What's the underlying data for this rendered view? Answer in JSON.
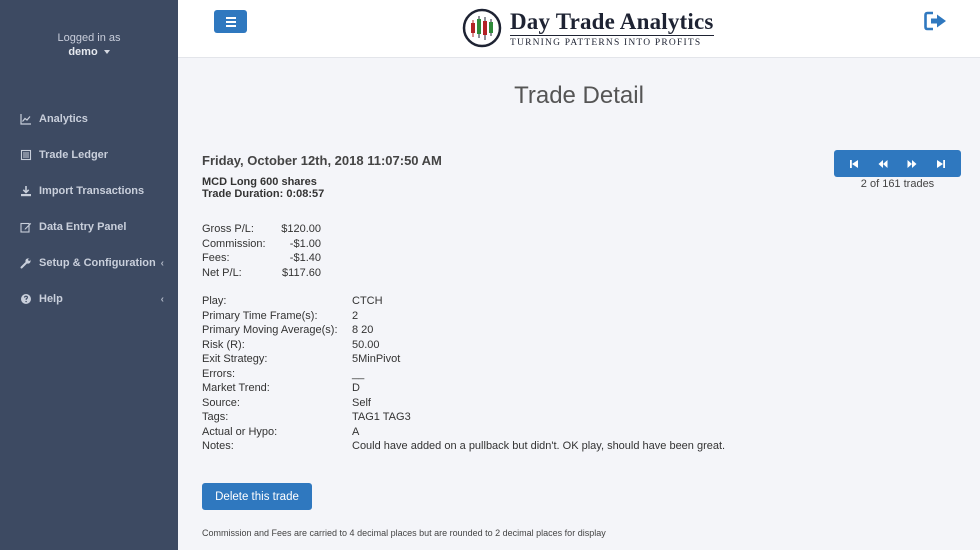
{
  "sidebar": {
    "logged_in_label": "Logged in as",
    "username": "demo",
    "items": [
      {
        "label": "Analytics",
        "icon": "line-chart-icon"
      },
      {
        "label": "Trade Ledger",
        "icon": "list-icon"
      },
      {
        "label": "Import Transactions",
        "icon": "download-icon"
      },
      {
        "label": "Data Entry Panel",
        "icon": "edit-icon"
      },
      {
        "label": "Setup & Configuration",
        "icon": "wrench-icon",
        "chevron": "‹"
      },
      {
        "label": "Help",
        "icon": "question-circle-icon",
        "chevron": "‹"
      }
    ]
  },
  "header": {
    "logo_title": "Day Trade Analytics",
    "logo_tagline": "TURNING PATTERNS INTO PROFITS"
  },
  "main": {
    "title": "Trade Detail",
    "trade_date": "Friday, October 12th, 2018 11:07:50 AM",
    "trade_summary": "MCD Long 600 shares",
    "trade_duration": "Trade Duration:  0:08:57",
    "pager_count": "2 of 161 trades",
    "pl": [
      {
        "k": "Gross P/L:",
        "v": "$120.00"
      },
      {
        "k": "Commission:",
        "v": "-$1.00"
      },
      {
        "k": "Fees:",
        "v": "-$1.40"
      },
      {
        "k": "Net P/L:",
        "v": "$117.60"
      }
    ],
    "meta": [
      {
        "k": "Play:",
        "v": "CTCH"
      },
      {
        "k": "Primary Time Frame(s):",
        "v": "2"
      },
      {
        "k": "Primary Moving Average(s):",
        "v": "8 20"
      },
      {
        "k": "Risk (R):",
        "v": "50.00"
      },
      {
        "k": "Exit Strategy:",
        "v": "5MinPivot"
      },
      {
        "k": "Errors:",
        "v": "__"
      },
      {
        "k": "Market Trend:",
        "v": "D"
      },
      {
        "k": "Source:",
        "v": "Self"
      },
      {
        "k": "Tags:",
        "v": "TAG1 TAG3"
      },
      {
        "k": "Actual or Hypo:",
        "v": "A"
      },
      {
        "k": "Notes:",
        "v": "Could have added on a pullback but didn't. OK play, should have been great."
      }
    ],
    "delete_label": "Delete this trade",
    "footnote": "Commission and Fees are carried to 4 decimal places but are rounded to 2 decimal places for display"
  },
  "colors": {
    "sidebar_bg": "#3d4a62",
    "accent": "#2f78bf",
    "page_bg": "#f4f5f9"
  }
}
